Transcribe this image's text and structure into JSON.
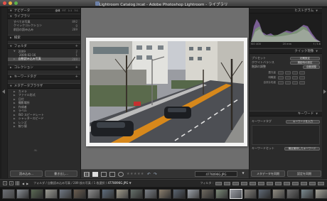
{
  "window": {
    "title": "Lightroom Catalog.lrcat - Adobe Photoshop Lightroom - ライブラリ"
  },
  "navigator": {
    "label": "ナビゲータ",
    "zoom_options": [
      "全体",
      "FIT",
      "1:1",
      "3:1"
    ]
  },
  "catalog": {
    "label": "ライブラリ",
    "rows": [
      {
        "label": "すべての写真",
        "count": "892"
      },
      {
        "label": "クイックコレクション",
        "count": "0"
      },
      {
        "label": "前回の読み込み",
        "count": "289"
      }
    ]
  },
  "folders_header": {
    "label": "検索"
  },
  "folders": {
    "label": "フォルダ",
    "rows": [
      {
        "label": "2009",
        "count": "2"
      },
      {
        "label": "2009-02-16",
        "count": "1"
      },
      {
        "label": "自動読み込み写真",
        "count": "289"
      }
    ]
  },
  "collections": {
    "label": "コレクション"
  },
  "keyword_tags": {
    "label": "キーワードタグ"
  },
  "metadata_browser": {
    "label": "メタデータブラウザ",
    "rows": [
      "カメラ",
      "ファイル形式",
      "日付",
      "撮影場所",
      "作成者",
      "ラベル",
      "ISO スピードレート",
      "シャッタースピード",
      "レンズ",
      "絞り値"
    ]
  },
  "left_buttons": {
    "import": "読み込み...",
    "export": "書き出し..."
  },
  "histogram": {
    "label": "ヒストグラム",
    "iso": "ISO 400",
    "focal": "20 mm",
    "aperture": "f / 5.6"
  },
  "quick_develop": {
    "label": "クイック現像",
    "preset_label": "プリセット",
    "preset_value": "初期設定",
    "wb_label": "ホワイトバランス",
    "wb_value": "撮影時の設定",
    "tone_label": "階調の調整",
    "tone_button": "自動調整",
    "sliders": [
      "露光量",
      "明瞭度",
      "自然な彩度"
    ]
  },
  "keywords_panel": {
    "label": "キーワード",
    "keyword_tags_label": "キーワードタグ",
    "keyword_tags_value": "キーワードを入力",
    "keyword_set_label": "キーワードセット",
    "keyword_set_value": "最近使用したキーワード"
  },
  "right_buttons": {
    "sync_meta": "メタデータを同期",
    "sync_settings": "設定を同期"
  },
  "toolbar": {
    "stars": "★★★★★",
    "filename": "4778096G.JPG"
  },
  "filmstrip": {
    "page_nums": [
      "1",
      "2"
    ],
    "path_prefix": "フォルダ / 自動読み込み写真 / 289 枚の写真 / 1 枚選択 /",
    "path_file": "4778096G.JPG",
    "path_arrow": "▼",
    "filter_label": "フィルタ :"
  },
  "colors": {
    "background": "#1c1c1c",
    "panel": "#2b2b2b",
    "center": "#6e6e6e",
    "selected_row": "#505050"
  }
}
